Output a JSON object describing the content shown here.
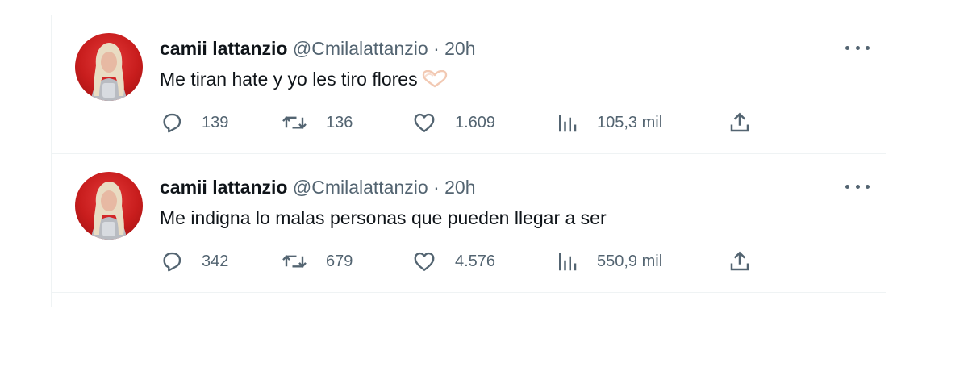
{
  "tweets": [
    {
      "name": "camii lattanzio",
      "handle": "@Cmilalattanzio",
      "separator": "·",
      "time": "20h",
      "text": "Me tiran hate y yo les tiro flores",
      "emoji": "heart-hands-emoji",
      "replies": "139",
      "retweets": "136",
      "likes": "1.609",
      "views": "105,3 mil"
    },
    {
      "name": "camii lattanzio",
      "handle": "@Cmilalattanzio",
      "separator": "·",
      "time": "20h",
      "text": "Me indigna lo malas personas que pueden llegar a ser",
      "replies": "342",
      "retweets": "679",
      "likes": "4.576",
      "views": "550,9 mil"
    }
  ],
  "colors": {
    "text_primary": "#0f1419",
    "text_secondary": "#536471",
    "divider": "#eff3f4",
    "avatar_background": "#c81d1d"
  }
}
